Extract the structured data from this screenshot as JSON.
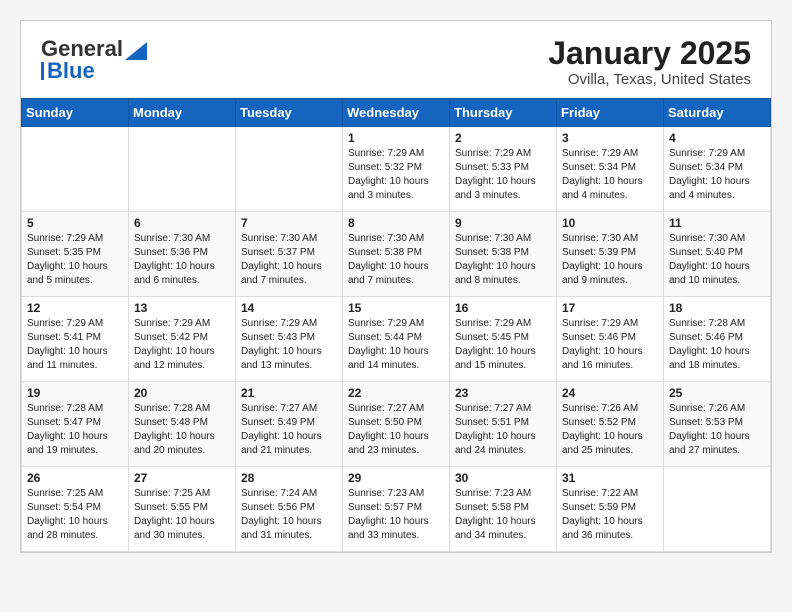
{
  "header": {
    "logo_top": "General",
    "logo_bottom": "Blue",
    "title": "January 2025",
    "subtitle": "Ovilla, Texas, United States"
  },
  "weekdays": [
    "Sunday",
    "Monday",
    "Tuesday",
    "Wednesday",
    "Thursday",
    "Friday",
    "Saturday"
  ],
  "weeks": [
    [
      {
        "day": "",
        "info": ""
      },
      {
        "day": "",
        "info": ""
      },
      {
        "day": "",
        "info": ""
      },
      {
        "day": "1",
        "info": "Sunrise: 7:29 AM\nSunset: 5:32 PM\nDaylight: 10 hours\nand 3 minutes."
      },
      {
        "day": "2",
        "info": "Sunrise: 7:29 AM\nSunset: 5:33 PM\nDaylight: 10 hours\nand 3 minutes."
      },
      {
        "day": "3",
        "info": "Sunrise: 7:29 AM\nSunset: 5:34 PM\nDaylight: 10 hours\nand 4 minutes."
      },
      {
        "day": "4",
        "info": "Sunrise: 7:29 AM\nSunset: 5:34 PM\nDaylight: 10 hours\nand 4 minutes."
      }
    ],
    [
      {
        "day": "5",
        "info": "Sunrise: 7:29 AM\nSunset: 5:35 PM\nDaylight: 10 hours\nand 5 minutes."
      },
      {
        "day": "6",
        "info": "Sunrise: 7:30 AM\nSunset: 5:36 PM\nDaylight: 10 hours\nand 6 minutes."
      },
      {
        "day": "7",
        "info": "Sunrise: 7:30 AM\nSunset: 5:37 PM\nDaylight: 10 hours\nand 7 minutes."
      },
      {
        "day": "8",
        "info": "Sunrise: 7:30 AM\nSunset: 5:38 PM\nDaylight: 10 hours\nand 7 minutes."
      },
      {
        "day": "9",
        "info": "Sunrise: 7:30 AM\nSunset: 5:38 PM\nDaylight: 10 hours\nand 8 minutes."
      },
      {
        "day": "10",
        "info": "Sunrise: 7:30 AM\nSunset: 5:39 PM\nDaylight: 10 hours\nand 9 minutes."
      },
      {
        "day": "11",
        "info": "Sunrise: 7:30 AM\nSunset: 5:40 PM\nDaylight: 10 hours\nand 10 minutes."
      }
    ],
    [
      {
        "day": "12",
        "info": "Sunrise: 7:29 AM\nSunset: 5:41 PM\nDaylight: 10 hours\nand 11 minutes."
      },
      {
        "day": "13",
        "info": "Sunrise: 7:29 AM\nSunset: 5:42 PM\nDaylight: 10 hours\nand 12 minutes."
      },
      {
        "day": "14",
        "info": "Sunrise: 7:29 AM\nSunset: 5:43 PM\nDaylight: 10 hours\nand 13 minutes."
      },
      {
        "day": "15",
        "info": "Sunrise: 7:29 AM\nSunset: 5:44 PM\nDaylight: 10 hours\nand 14 minutes."
      },
      {
        "day": "16",
        "info": "Sunrise: 7:29 AM\nSunset: 5:45 PM\nDaylight: 10 hours\nand 15 minutes."
      },
      {
        "day": "17",
        "info": "Sunrise: 7:29 AM\nSunset: 5:46 PM\nDaylight: 10 hours\nand 16 minutes."
      },
      {
        "day": "18",
        "info": "Sunrise: 7:28 AM\nSunset: 5:46 PM\nDaylight: 10 hours\nand 18 minutes."
      }
    ],
    [
      {
        "day": "19",
        "info": "Sunrise: 7:28 AM\nSunset: 5:47 PM\nDaylight: 10 hours\nand 19 minutes."
      },
      {
        "day": "20",
        "info": "Sunrise: 7:28 AM\nSunset: 5:48 PM\nDaylight: 10 hours\nand 20 minutes."
      },
      {
        "day": "21",
        "info": "Sunrise: 7:27 AM\nSunset: 5:49 PM\nDaylight: 10 hours\nand 21 minutes."
      },
      {
        "day": "22",
        "info": "Sunrise: 7:27 AM\nSunset: 5:50 PM\nDaylight: 10 hours\nand 23 minutes."
      },
      {
        "day": "23",
        "info": "Sunrise: 7:27 AM\nSunset: 5:51 PM\nDaylight: 10 hours\nand 24 minutes."
      },
      {
        "day": "24",
        "info": "Sunrise: 7:26 AM\nSunset: 5:52 PM\nDaylight: 10 hours\nand 25 minutes."
      },
      {
        "day": "25",
        "info": "Sunrise: 7:26 AM\nSunset: 5:53 PM\nDaylight: 10 hours\nand 27 minutes."
      }
    ],
    [
      {
        "day": "26",
        "info": "Sunrise: 7:25 AM\nSunset: 5:54 PM\nDaylight: 10 hours\nand 28 minutes."
      },
      {
        "day": "27",
        "info": "Sunrise: 7:25 AM\nSunset: 5:55 PM\nDaylight: 10 hours\nand 30 minutes."
      },
      {
        "day": "28",
        "info": "Sunrise: 7:24 AM\nSunset: 5:56 PM\nDaylight: 10 hours\nand 31 minutes."
      },
      {
        "day": "29",
        "info": "Sunrise: 7:23 AM\nSunset: 5:57 PM\nDaylight: 10 hours\nand 33 minutes."
      },
      {
        "day": "30",
        "info": "Sunrise: 7:23 AM\nSunset: 5:58 PM\nDaylight: 10 hours\nand 34 minutes."
      },
      {
        "day": "31",
        "info": "Sunrise: 7:22 AM\nSunset: 5:59 PM\nDaylight: 10 hours\nand 36 minutes."
      },
      {
        "day": "",
        "info": ""
      }
    ]
  ]
}
